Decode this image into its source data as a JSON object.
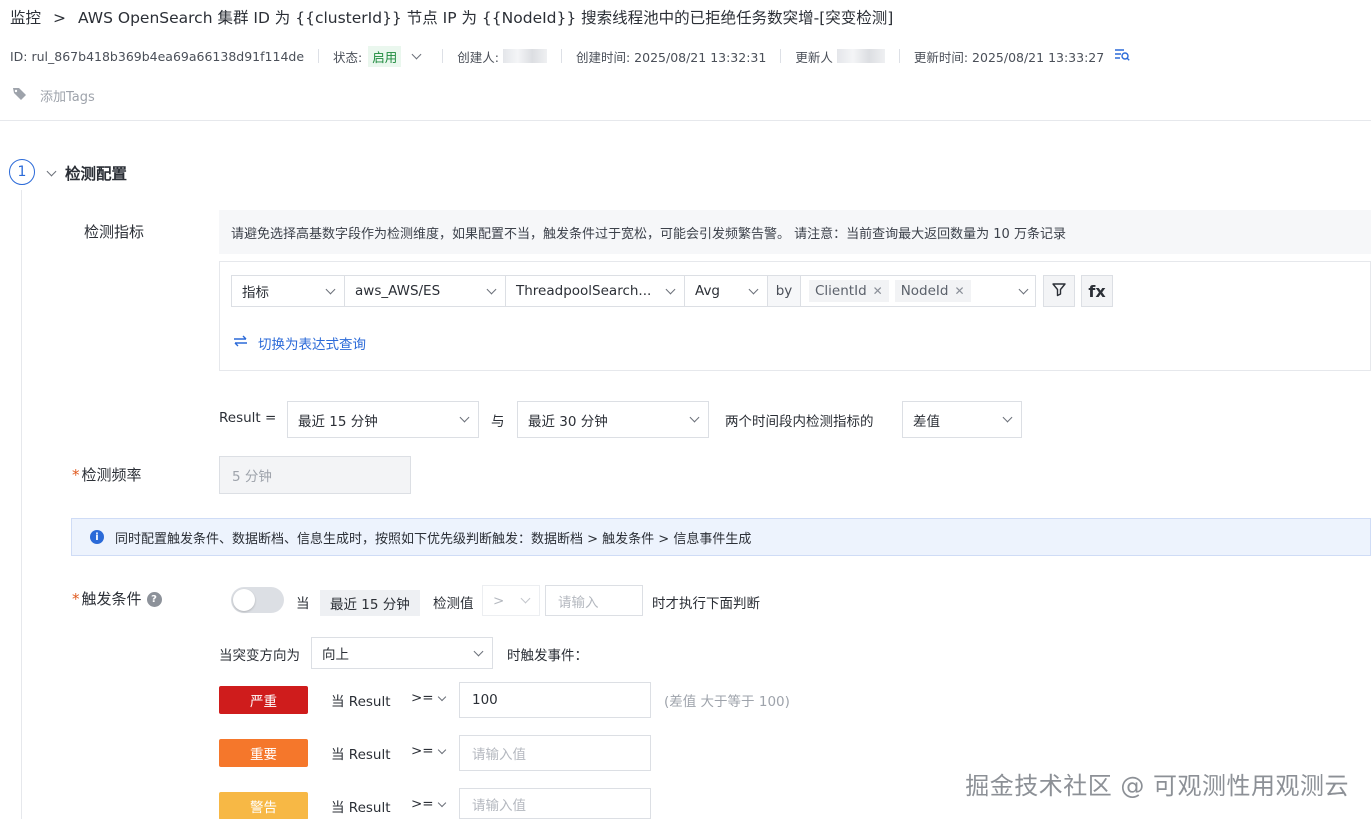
{
  "breadcrumb": {
    "root": "监控",
    "separator": ">",
    "title": "AWS OpenSearch 集群 ID 为 {{clusterId}} 节点 IP 为 {{NodeId}} 搜索线程池中的已拒绝任务数突增-[突变检测]"
  },
  "meta": {
    "id": "ID: rul_867b418b369b4ea69a66138d91f114de",
    "status_label": "状态:",
    "status_value": "启用",
    "creator_label": "创建人:",
    "created_time": "创建时间: 2025/08/21 13:32:31",
    "updater_label": "更新人",
    "updated_time": "更新时间: 2025/08/21 13:33:27"
  },
  "tags": {
    "add_label": "添加Tags"
  },
  "section": {
    "number": "1",
    "title": "检测配置"
  },
  "metric": {
    "label": "检测指标",
    "hint": "请避免选择高基数字段作为检测维度，如果配置不当，触发条件过于宽松，可能会引发频繁告警。 请注意：当前查询最大返回数量为 10 万条记录",
    "type_select": "指标",
    "namespace_select": "aws_AWS/ES",
    "metric_select": "ThreadpoolSearch...",
    "agg_select": "Avg",
    "by_label": "by",
    "group_tags": [
      "ClientId",
      "NodeId"
    ],
    "fx_label": "fx",
    "switch_link": "切换为表达式查询"
  },
  "result": {
    "label": "Result =",
    "range1": "最近 15 分钟",
    "and_label": "与",
    "range2": "最近 30 分钟",
    "between_label": "两个时间段内检测指标的",
    "mode": "差值"
  },
  "frequency": {
    "label": "检测频率",
    "value": "5 分钟"
  },
  "info": {
    "text": "同时配置触发条件、数据断档、信息生成时，按照如下优先级判断触发：数据断档 > 触发条件 > 信息事件生成"
  },
  "trigger": {
    "label": "触发条件",
    "when": "当",
    "window": "最近 15 分钟",
    "check_value": "检测值",
    "op": ">",
    "input_placeholder": "请输入",
    "then_text": "时才执行下面判断",
    "direction_prefix": "当突变方向为",
    "direction": "向上",
    "direction_suffix": "时触发事件：",
    "rules": [
      {
        "level": "严重",
        "color": "#cf1c1c",
        "when": "当 Result",
        "op": ">=",
        "value": "100",
        "placeholder": "请输入值",
        "note": "(差值 大于等于 100)"
      },
      {
        "level": "重要",
        "color": "#f5772b",
        "when": "当 Result",
        "op": ">=",
        "value": "",
        "placeholder": "请输入值",
        "note": ""
      },
      {
        "level": "警告",
        "color": "#f7b845",
        "when": "当 Result",
        "op": ">=",
        "value": "",
        "placeholder": "请输入值",
        "note": ""
      }
    ]
  },
  "watermark": "掘金技术社区 @ 可观测性用观测云"
}
